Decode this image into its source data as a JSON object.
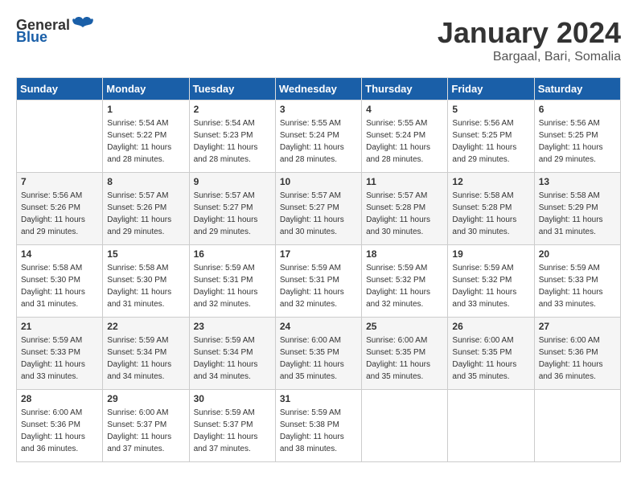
{
  "logo": {
    "general": "General",
    "blue": "Blue"
  },
  "title": {
    "month_year": "January 2024",
    "location": "Bargaal, Bari, Somalia"
  },
  "weekdays": [
    "Sunday",
    "Monday",
    "Tuesday",
    "Wednesday",
    "Thursday",
    "Friday",
    "Saturday"
  ],
  "weeks": [
    [
      {
        "day": "",
        "sunrise": "",
        "sunset": "",
        "daylight": ""
      },
      {
        "day": "1",
        "sunrise": "Sunrise: 5:54 AM",
        "sunset": "Sunset: 5:22 PM",
        "daylight": "Daylight: 11 hours and 28 minutes."
      },
      {
        "day": "2",
        "sunrise": "Sunrise: 5:54 AM",
        "sunset": "Sunset: 5:23 PM",
        "daylight": "Daylight: 11 hours and 28 minutes."
      },
      {
        "day": "3",
        "sunrise": "Sunrise: 5:55 AM",
        "sunset": "Sunset: 5:24 PM",
        "daylight": "Daylight: 11 hours and 28 minutes."
      },
      {
        "day": "4",
        "sunrise": "Sunrise: 5:55 AM",
        "sunset": "Sunset: 5:24 PM",
        "daylight": "Daylight: 11 hours and 28 minutes."
      },
      {
        "day": "5",
        "sunrise": "Sunrise: 5:56 AM",
        "sunset": "Sunset: 5:25 PM",
        "daylight": "Daylight: 11 hours and 29 minutes."
      },
      {
        "day": "6",
        "sunrise": "Sunrise: 5:56 AM",
        "sunset": "Sunset: 5:25 PM",
        "daylight": "Daylight: 11 hours and 29 minutes."
      }
    ],
    [
      {
        "day": "7",
        "sunrise": "Sunrise: 5:56 AM",
        "sunset": "Sunset: 5:26 PM",
        "daylight": "Daylight: 11 hours and 29 minutes."
      },
      {
        "day": "8",
        "sunrise": "Sunrise: 5:57 AM",
        "sunset": "Sunset: 5:26 PM",
        "daylight": "Daylight: 11 hours and 29 minutes."
      },
      {
        "day": "9",
        "sunrise": "Sunrise: 5:57 AM",
        "sunset": "Sunset: 5:27 PM",
        "daylight": "Daylight: 11 hours and 29 minutes."
      },
      {
        "day": "10",
        "sunrise": "Sunrise: 5:57 AM",
        "sunset": "Sunset: 5:27 PM",
        "daylight": "Daylight: 11 hours and 30 minutes."
      },
      {
        "day": "11",
        "sunrise": "Sunrise: 5:57 AM",
        "sunset": "Sunset: 5:28 PM",
        "daylight": "Daylight: 11 hours and 30 minutes."
      },
      {
        "day": "12",
        "sunrise": "Sunrise: 5:58 AM",
        "sunset": "Sunset: 5:28 PM",
        "daylight": "Daylight: 11 hours and 30 minutes."
      },
      {
        "day": "13",
        "sunrise": "Sunrise: 5:58 AM",
        "sunset": "Sunset: 5:29 PM",
        "daylight": "Daylight: 11 hours and 31 minutes."
      }
    ],
    [
      {
        "day": "14",
        "sunrise": "Sunrise: 5:58 AM",
        "sunset": "Sunset: 5:30 PM",
        "daylight": "Daylight: 11 hours and 31 minutes."
      },
      {
        "day": "15",
        "sunrise": "Sunrise: 5:58 AM",
        "sunset": "Sunset: 5:30 PM",
        "daylight": "Daylight: 11 hours and 31 minutes."
      },
      {
        "day": "16",
        "sunrise": "Sunrise: 5:59 AM",
        "sunset": "Sunset: 5:31 PM",
        "daylight": "Daylight: 11 hours and 32 minutes."
      },
      {
        "day": "17",
        "sunrise": "Sunrise: 5:59 AM",
        "sunset": "Sunset: 5:31 PM",
        "daylight": "Daylight: 11 hours and 32 minutes."
      },
      {
        "day": "18",
        "sunrise": "Sunrise: 5:59 AM",
        "sunset": "Sunset: 5:32 PM",
        "daylight": "Daylight: 11 hours and 32 minutes."
      },
      {
        "day": "19",
        "sunrise": "Sunrise: 5:59 AM",
        "sunset": "Sunset: 5:32 PM",
        "daylight": "Daylight: 11 hours and 33 minutes."
      },
      {
        "day": "20",
        "sunrise": "Sunrise: 5:59 AM",
        "sunset": "Sunset: 5:33 PM",
        "daylight": "Daylight: 11 hours and 33 minutes."
      }
    ],
    [
      {
        "day": "21",
        "sunrise": "Sunrise: 5:59 AM",
        "sunset": "Sunset: 5:33 PM",
        "daylight": "Daylight: 11 hours and 33 minutes."
      },
      {
        "day": "22",
        "sunrise": "Sunrise: 5:59 AM",
        "sunset": "Sunset: 5:34 PM",
        "daylight": "Daylight: 11 hours and 34 minutes."
      },
      {
        "day": "23",
        "sunrise": "Sunrise: 5:59 AM",
        "sunset": "Sunset: 5:34 PM",
        "daylight": "Daylight: 11 hours and 34 minutes."
      },
      {
        "day": "24",
        "sunrise": "Sunrise: 6:00 AM",
        "sunset": "Sunset: 5:35 PM",
        "daylight": "Daylight: 11 hours and 35 minutes."
      },
      {
        "day": "25",
        "sunrise": "Sunrise: 6:00 AM",
        "sunset": "Sunset: 5:35 PM",
        "daylight": "Daylight: 11 hours and 35 minutes."
      },
      {
        "day": "26",
        "sunrise": "Sunrise: 6:00 AM",
        "sunset": "Sunset: 5:35 PM",
        "daylight": "Daylight: 11 hours and 35 minutes."
      },
      {
        "day": "27",
        "sunrise": "Sunrise: 6:00 AM",
        "sunset": "Sunset: 5:36 PM",
        "daylight": "Daylight: 11 hours and 36 minutes."
      }
    ],
    [
      {
        "day": "28",
        "sunrise": "Sunrise: 6:00 AM",
        "sunset": "Sunset: 5:36 PM",
        "daylight": "Daylight: 11 hours and 36 minutes."
      },
      {
        "day": "29",
        "sunrise": "Sunrise: 6:00 AM",
        "sunset": "Sunset: 5:37 PM",
        "daylight": "Daylight: 11 hours and 37 minutes."
      },
      {
        "day": "30",
        "sunrise": "Sunrise: 5:59 AM",
        "sunset": "Sunset: 5:37 PM",
        "daylight": "Daylight: 11 hours and 37 minutes."
      },
      {
        "day": "31",
        "sunrise": "Sunrise: 5:59 AM",
        "sunset": "Sunset: 5:38 PM",
        "daylight": "Daylight: 11 hours and 38 minutes."
      },
      {
        "day": "",
        "sunrise": "",
        "sunset": "",
        "daylight": ""
      },
      {
        "day": "",
        "sunrise": "",
        "sunset": "",
        "daylight": ""
      },
      {
        "day": "",
        "sunrise": "",
        "sunset": "",
        "daylight": ""
      }
    ]
  ]
}
